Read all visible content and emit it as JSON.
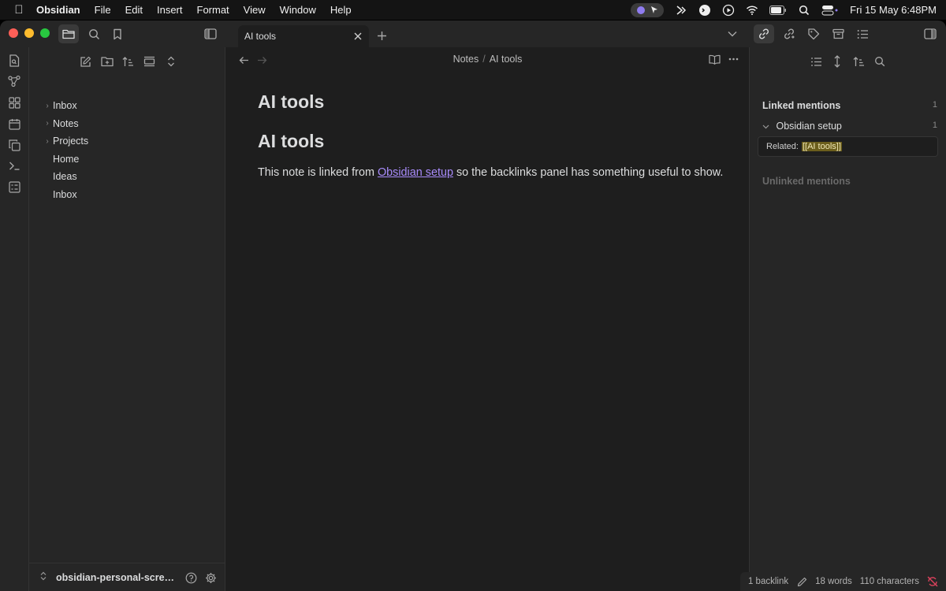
{
  "menubar": {
    "app_name": "Obsidian",
    "items": [
      "File",
      "Edit",
      "Insert",
      "Format",
      "View",
      "Window",
      "Help"
    ],
    "clock": "Fri 15 May  6:48PM"
  },
  "tab": {
    "title": "AI tools"
  },
  "file_explorer": {
    "folders": [
      {
        "label": "Inbox"
      },
      {
        "label": "Notes"
      },
      {
        "label": "Projects"
      }
    ],
    "files": [
      {
        "label": "Home"
      },
      {
        "label": "Ideas"
      },
      {
        "label": "Inbox"
      }
    ],
    "vault_name": "obsidian-personal-screenshots"
  },
  "editor": {
    "breadcrumb": {
      "folder": "Notes",
      "separator": "/",
      "file": "AI tools"
    },
    "inline_title": "AI tools",
    "heading": "AI tools",
    "paragraph": {
      "before": "This note is linked from ",
      "link": "Obsidian setup",
      "after": " so the backlinks panel has something useful to show."
    }
  },
  "backlinks": {
    "linked_title": "Linked mentions",
    "linked_count": "1",
    "source_file": "Obsidian setup",
    "source_count": "1",
    "snippet_prefix": "Related:",
    "snippet_link": "[[AI tools]]",
    "unlinked_title": "Unlinked mentions"
  },
  "statusbar": {
    "backlinks": "1 backlink",
    "words": "18 words",
    "characters": "110 characters"
  },
  "colors": {
    "accent_link": "#a88bfa",
    "highlight": "#6b5e1c",
    "sync_off": "#e0435e"
  }
}
